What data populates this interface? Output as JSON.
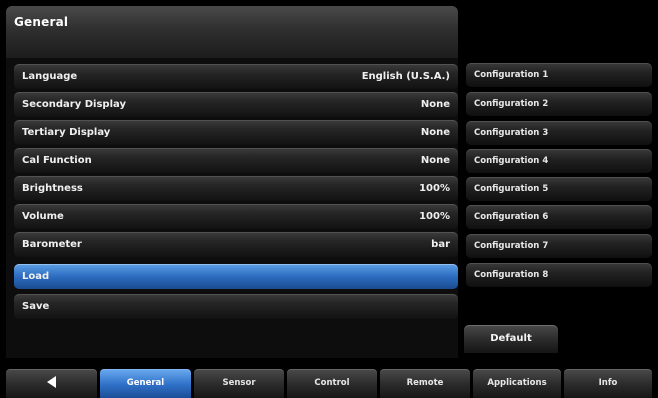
{
  "header": {
    "title": "General"
  },
  "settings": [
    {
      "label": "Language",
      "value": "English (U.S.A.)"
    },
    {
      "label": "Secondary Display",
      "value": "None"
    },
    {
      "label": "Tertiary Display",
      "value": "None"
    },
    {
      "label": "Cal Function",
      "value": "None"
    },
    {
      "label": "Brightness",
      "value": "100%"
    },
    {
      "label": "Volume",
      "value": "100%"
    },
    {
      "label": "Barometer",
      "value": "bar"
    },
    {
      "label": "Load",
      "value": ""
    },
    {
      "label": "Save",
      "value": ""
    }
  ],
  "selected_setting": "Load",
  "configurations": [
    "Configuration 1",
    "Configuration 2",
    "Configuration 3",
    "Configuration 4",
    "Configuration 5",
    "Configuration 6",
    "Configuration 7",
    "Configuration 8"
  ],
  "default_button": "Default",
  "tabs": {
    "back_icon": "left-arrow-icon",
    "items": [
      "General",
      "Sensor",
      "Control",
      "Remote",
      "Applications",
      "Info"
    ],
    "active": "General"
  },
  "colors": {
    "background": "#000000",
    "selected_blue": "#2d6cc0",
    "row_dark": "#262626"
  }
}
